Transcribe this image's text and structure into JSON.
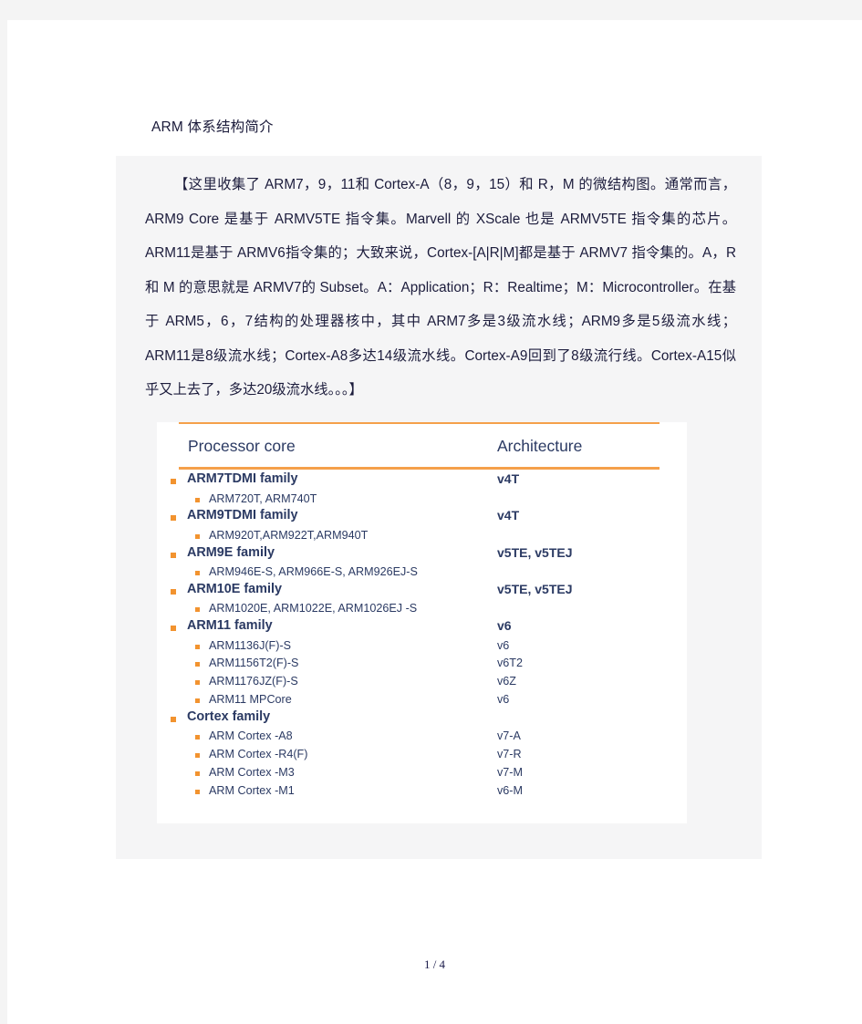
{
  "document": {
    "title": "ARM 体系结构简介",
    "paragraph": "【这里收集了 ARM7，9，11和 Cortex-A（8，9，15）和 R，M 的微结构图。通常而言，ARM9 Core 是基于 ARMV5TE 指令集。Marvell 的 XScale 也是 ARMV5TE 指令集的芯片。ARM11是基于 ARMV6指令集的；大致来说，Cortex-[A|R|M]都是基于 ARMV7 指令集的。A，R 和 M 的意思就是 ARMV7的 Subset。A：Application；R：Realtime；M：Microcontroller。在基于 ARM5，6，7结构的处理器核中，其中 ARM7多是3级流水线；ARM9多是5级流水线；ARM11是8级流水线；Cortex-A8多达14级流水线。Cortex-A9回到了8级流行线。Cortex-A15似乎又上去了，多达20级流水线。。。】",
    "footer": "1 / 4"
  },
  "figure": {
    "colors": {
      "rule": "#f5a04a",
      "bullet": "#f2932f",
      "text": "#2b3a63"
    },
    "headers": {
      "core": "Processor core",
      "architecture": "Architecture"
    },
    "rows": [
      {
        "level": 1,
        "core": "ARM7TDMI family",
        "arch": "v4T"
      },
      {
        "level": 2,
        "core": "ARM720T, ARM740T",
        "arch": ""
      },
      {
        "level": 1,
        "core": "ARM9TDMI family",
        "arch": "v4T"
      },
      {
        "level": 2,
        "core": "ARM920T,ARM922T,ARM940T",
        "arch": ""
      },
      {
        "level": 1,
        "core": "ARM9E family",
        "arch": "v5TE, v5TEJ"
      },
      {
        "level": 2,
        "core": "ARM946E-S, ARM966E-S, ARM926EJ-S",
        "arch": ""
      },
      {
        "level": 1,
        "core": "ARM10E family",
        "arch": "v5TE, v5TEJ"
      },
      {
        "level": 2,
        "core": "ARM1020E, ARM1022E, ARM1026EJ -S",
        "arch": ""
      },
      {
        "level": 1,
        "core": "ARM11 family",
        "arch": "v6"
      },
      {
        "level": 2,
        "core": "ARM1136J(F)-S",
        "arch": "v6"
      },
      {
        "level": 2,
        "core": "ARM1156T2(F)-S",
        "arch": "v6T2"
      },
      {
        "level": 2,
        "core": "ARM1176JZ(F)-S",
        "arch": "v6Z"
      },
      {
        "level": 2,
        "core": "ARM11 MPCore",
        "arch": "v6"
      },
      {
        "level": 1,
        "core": "Cortex family",
        "arch": ""
      },
      {
        "level": 2,
        "core": "ARM Cortex -A8",
        "arch": "v7-A"
      },
      {
        "level": 2,
        "core": "ARM Cortex -R4(F)",
        "arch": "v7-R"
      },
      {
        "level": 2,
        "core": "ARM Cortex -M3",
        "arch": "v7-M"
      },
      {
        "level": 2,
        "core": "ARM Cortex -M1",
        "arch": "v6-M"
      }
    ]
  }
}
